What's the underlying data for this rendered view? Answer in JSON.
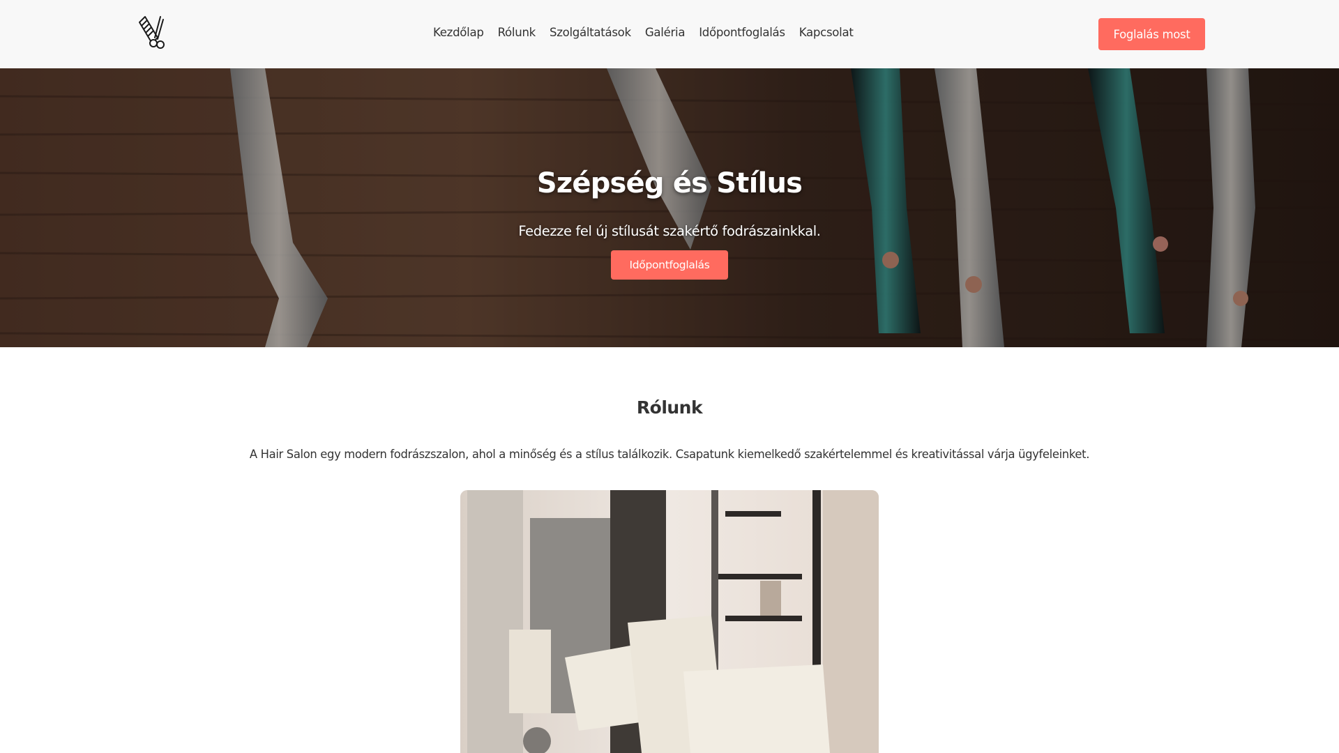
{
  "header": {
    "logo_icon": "scissors-comb-icon",
    "nav": [
      {
        "label": "Kezdőlap"
      },
      {
        "label": "Rólunk"
      },
      {
        "label": "Szolgáltatások"
      },
      {
        "label": "Galéria"
      },
      {
        "label": "Időpontfoglalás"
      },
      {
        "label": "Kapcsolat"
      }
    ],
    "cta_label": "Foglalás most"
  },
  "hero": {
    "title": "Szépség és Stílus",
    "subtitle": "Fedezze fel új stílusát szakértő fodrászainkkal.",
    "button_label": "Időpontfoglalás",
    "image": "scissors-on-wood-photo"
  },
  "about": {
    "title": "Rólunk",
    "text": "A Hair Salon egy modern fodrászszalon, ahol a minőség és a stílus találkozik. Csapatunk kiemelkedő szakértelemmel és kreativitással várja ügyfeleinket.",
    "image": "salon-interior-photo"
  },
  "colors": {
    "accent": "#ff6b5f",
    "header_bg": "#f8f8f8",
    "text": "#333333"
  }
}
